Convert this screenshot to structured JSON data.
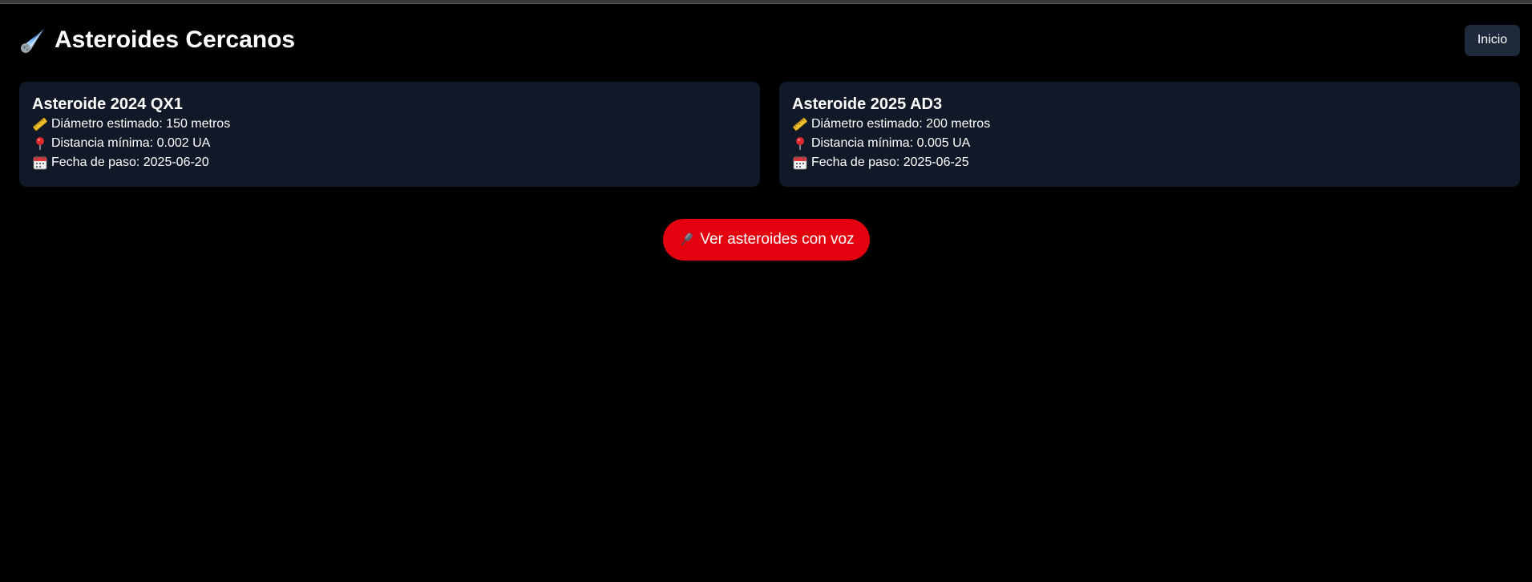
{
  "header": {
    "title": "Asteroides Cercanos",
    "title_icon": "comet-icon",
    "home_label": "Inicio"
  },
  "asteroids": [
    {
      "name": "Asteroide 2024 QX1",
      "diameter": "Diámetro estimado: 150 metros",
      "distance": "Distancia mínima: 0.002 UA",
      "date": "Fecha de paso: 2025-06-20"
    },
    {
      "name": "Asteroide 2025 AD3",
      "diameter": "Diámetro estimado: 200 metros",
      "distance": "Distancia mínima: 0.005 UA",
      "date": "Fecha de paso: 2025-06-25"
    }
  ],
  "row_icons": {
    "diameter": "ruler-icon",
    "distance": "pin-icon",
    "date": "calendar-icon"
  },
  "voice_button": {
    "label": "Ver asteroides con voz",
    "icon": "microphone-icon"
  },
  "colors": {
    "background": "#000000",
    "card": "#111827",
    "home_button": "#1e293b",
    "voice_button": "#e4000f"
  }
}
